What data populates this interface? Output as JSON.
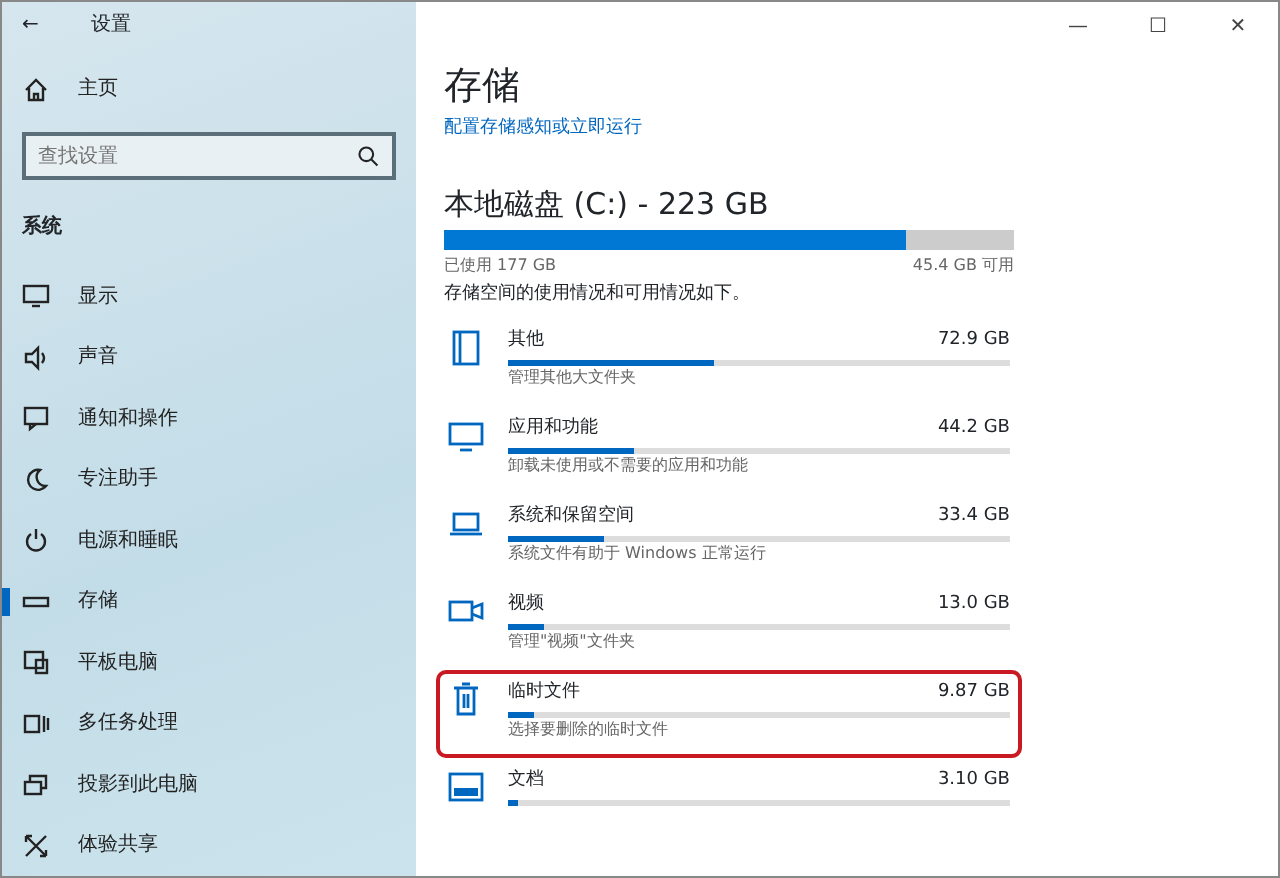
{
  "window": {
    "title": "设置",
    "back": "←",
    "controls": [
      "—",
      "☐",
      "✕"
    ]
  },
  "sidebar": {
    "home": "主页",
    "search": {
      "placeholder": "查找设置"
    },
    "section": "系统",
    "items": [
      {
        "label": "显示",
        "selected": false
      },
      {
        "label": "声音",
        "selected": false
      },
      {
        "label": "通知和操作",
        "selected": false
      },
      {
        "label": "专注助手",
        "selected": false
      },
      {
        "label": "电源和睡眠",
        "selected": false
      },
      {
        "label": "存储",
        "selected": true
      },
      {
        "label": "平板电脑",
        "selected": false
      },
      {
        "label": "多任务处理",
        "selected": false
      },
      {
        "label": "投影到此电脑",
        "selected": false
      },
      {
        "label": "体验共享",
        "selected": false
      }
    ]
  },
  "main": {
    "title": "存储",
    "link": "配置存储感知或立即运行",
    "disk": {
      "title": "本地磁盘 (C:) - 223 GB",
      "level": 0.81,
      "used": "已使用 177 GB",
      "free": "45.4 GB 可用"
    },
    "intro": "存储空间的使用情况和可用情况如下。",
    "categories": [
      {
        "name": "其他",
        "size": "72.9 GB",
        "level": 0.41,
        "desc": "管理其他大文件夹",
        "highlighted": false
      },
      {
        "name": "应用和功能",
        "size": "44.2 GB",
        "level": 0.25,
        "desc": "卸载未使用或不需要的应用和功能",
        "highlighted": false
      },
      {
        "name": "系统和保留空间",
        "size": "33.4 GB",
        "level": 0.19,
        "desc": "系统文件有助于 Windows 正常运行",
        "highlighted": false
      },
      {
        "name": "视频",
        "size": "13.0 GB",
        "level": 0.07,
        "desc": "管理\"视频\"文件夹",
        "highlighted": false
      },
      {
        "name": "临时文件",
        "size": "9.87 GB",
        "level": 0.05,
        "desc": "选择要删除的临时文件",
        "highlighted": true
      },
      {
        "name": "文档",
        "size": "3.10 GB",
        "level": 0.02,
        "highlighted": false
      }
    ]
  }
}
